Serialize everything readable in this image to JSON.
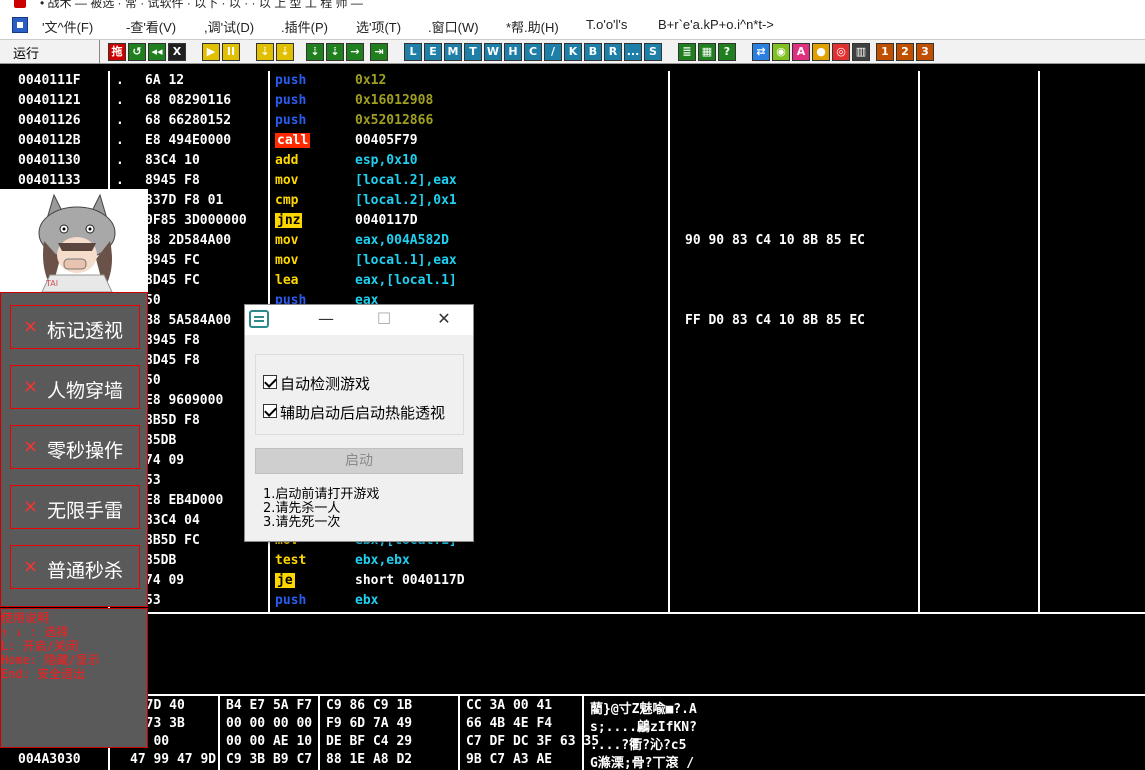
{
  "window": {
    "title_fragment": "• 战术 — 被选 · 常 · 试软件 · 以下 · 以 · · 以 上 型 工 程 师 —"
  },
  "menubar": {
    "items": [
      "'文^件(F)",
      "-查'看(V)",
      ",调'试(D)",
      ".插件(P)",
      "选'项(T)",
      ".窗口(W)",
      "*帮.助(H)",
      "T.o'o'l's",
      "B+r`e'a.kP+o.i^n*t->"
    ]
  },
  "toolbar": {
    "status": "运行",
    "buttons": [
      {
        "label": "拖",
        "bg": "#d00000"
      },
      {
        "label": "↺",
        "bg": "#208020"
      },
      {
        "label": "◂◂",
        "bg": "#208020"
      },
      {
        "label": "X",
        "bg": "#202020"
      },
      {
        "label": "▶",
        "bg": "#e0c000"
      },
      {
        "label": "II",
        "bg": "#e0c000"
      },
      {
        "label": "⇣",
        "bg": "#e0c000"
      },
      {
        "label": "⇣",
        "bg": "#e0c000"
      },
      {
        "label": "⇣",
        "bg": "#208020"
      },
      {
        "label": "⇣",
        "bg": "#208020"
      },
      {
        "label": "→",
        "bg": "#208020"
      },
      {
        "label": "⇥",
        "bg": "#208020"
      },
      {
        "label": "L",
        "bg": "#1e7fa8"
      },
      {
        "label": "E",
        "bg": "#1e7fa8"
      },
      {
        "label": "M",
        "bg": "#1e7fa8"
      },
      {
        "label": "T",
        "bg": "#1e7fa8"
      },
      {
        "label": "W",
        "bg": "#1e7fa8"
      },
      {
        "label": "H",
        "bg": "#1e7fa8"
      },
      {
        "label": "C",
        "bg": "#1e7fa8"
      },
      {
        "label": "/",
        "bg": "#1e7fa8"
      },
      {
        "label": "K",
        "bg": "#1e7fa8"
      },
      {
        "label": "B",
        "bg": "#1e7fa8"
      },
      {
        "label": "R",
        "bg": "#1e7fa8"
      },
      {
        "label": "...",
        "bg": "#1e7fa8"
      },
      {
        "label": "S",
        "bg": "#1e7fa8"
      },
      {
        "label": "≣",
        "bg": "#208020"
      },
      {
        "label": "▦",
        "bg": "#208020"
      },
      {
        "label": "?",
        "bg": "#208020"
      },
      {
        "label": "⇄",
        "bg": "#2a80e0"
      },
      {
        "label": "◉",
        "bg": "#80c020"
      },
      {
        "label": "A",
        "bg": "#e03080"
      },
      {
        "label": "●",
        "bg": "#e0a000"
      },
      {
        "label": "◎",
        "bg": "#e03030"
      },
      {
        "label": "▥",
        "bg": "#404040"
      },
      {
        "label": "1",
        "bg": "#c05000"
      },
      {
        "label": "2",
        "bg": "#c05000"
      },
      {
        "label": "3",
        "bg": "#c05000"
      }
    ]
  },
  "disasm_rows": [
    {
      "addr": "0040111F",
      "dot": ".",
      "hex": "6A 12",
      "mn": "push",
      "op": "0x12",
      "op_cls": "op-y",
      "cm": ""
    },
    {
      "addr": "00401121",
      "dot": ".",
      "hex": "68 08290116",
      "mn": "push",
      "op": "0x16012908",
      "op_cls": "op-y",
      "cm": ""
    },
    {
      "addr": "00401126",
      "dot": ".",
      "hex": "68 66280152",
      "mn": "push",
      "op": "0x52012866",
      "op_cls": "op-y",
      "cm": ""
    },
    {
      "addr": "0040112B",
      "dot": ".",
      "hex": "E8 494E0000",
      "mn": "call",
      "op": "00405F79",
      "op_cls": "op-w",
      "cm": ""
    },
    {
      "addr": "00401130",
      "dot": ".",
      "hex": "83C4 10",
      "mn": "add",
      "op": "esp,0x10",
      "op_cls": "op-c",
      "cm": ""
    },
    {
      "addr": "00401133",
      "dot": ".",
      "hex": "8945 F8",
      "mn": "mov",
      "op": "[local.2],eax",
      "op_cls": "op-c",
      "cm": ""
    },
    {
      "addr": "",
      "dot": "",
      "hex": "837D F8 01",
      "mn": "cmp",
      "op": "[local.2],0x1",
      "op_cls": "op-c",
      "cm": ""
    },
    {
      "addr": "",
      "dot": "",
      "hex": "0F85 3D000000",
      "mn": "jnz",
      "op": "0040117D",
      "op_cls": "op-w",
      "cm": ""
    },
    {
      "addr": "",
      "dot": "",
      "hex": "B8 2D584A00",
      "mn": "mov",
      "op": "eax,004A582D",
      "op_cls": "op-c",
      "cm": "90 90 83 C4 10 8B 85 EC"
    },
    {
      "addr": "",
      "dot": "",
      "hex": "8945 FC",
      "mn": "mov",
      "op": "[local.1],eax",
      "op_cls": "op-c",
      "cm": ""
    },
    {
      "addr": "",
      "dot": "",
      "hex": "8D45 FC",
      "mn": "lea",
      "op": "eax,[local.1]",
      "op_cls": "op-c",
      "cm": ""
    },
    {
      "addr": "",
      "dot": "",
      "hex": "50",
      "mn": "push",
      "op": "eax",
      "op_cls": "op-c",
      "cm": ""
    },
    {
      "addr": "",
      "dot": "",
      "hex": "B8 5A584A00",
      "mn": "",
      "op": "",
      "op_cls": "op-c",
      "cm": "FF D0 83 C4 10 8B 85 EC"
    },
    {
      "addr": "",
      "dot": "",
      "hex": "8945 F8",
      "mn": "",
      "op": "x",
      "op_cls": "op-c",
      "cm": ""
    },
    {
      "addr": "",
      "dot": "",
      "hex": "8D45 F8",
      "mn": "",
      "op": "]",
      "op_cls": "op-c",
      "cm": ""
    },
    {
      "addr": "",
      "dot": "",
      "hex": "50",
      "mn": "",
      "op": "",
      "op_cls": "op-c",
      "cm": ""
    },
    {
      "addr": "",
      "dot": "",
      "hex": "E8 9609000",
      "mn": "",
      "op": "",
      "op_cls": "op-c",
      "cm": ""
    },
    {
      "addr": "",
      "dot": "",
      "hex": "8B5D F8",
      "mn": "",
      "op": "]",
      "op_cls": "op-c",
      "cm": ""
    },
    {
      "addr": "",
      "dot": "",
      "hex": "85DB",
      "mn": "",
      "op": "",
      "op_cls": "op-c",
      "cm": ""
    },
    {
      "addr": "",
      "dot": "",
      "hex": "74 09",
      "mn": "",
      "op": "6D",
      "op_cls": "op-w",
      "cm": ""
    },
    {
      "addr": "",
      "dot": "",
      "hex": "53",
      "mn": "",
      "op": "",
      "op_cls": "op-c",
      "cm": ""
    },
    {
      "addr": "",
      "dot": "",
      "hex": "E8 EB4D000",
      "mn": "",
      "op": "",
      "op_cls": "op-c",
      "cm": ""
    },
    {
      "addr": "",
      "dot": "",
      "hex": "83C4 04",
      "mn": "",
      "op": "",
      "op_cls": "op-c",
      "cm": ""
    },
    {
      "addr": "",
      "dot": "",
      "hex": "8B5D FC",
      "mn": "mov",
      "op": "ebx,[local.1]",
      "op_cls": "op-c",
      "cm": ""
    },
    {
      "addr": "",
      "dot": "",
      "hex": "85DB",
      "mn": "test",
      "op": "ebx,ebx",
      "op_cls": "op-c",
      "cm": ""
    },
    {
      "addr": "",
      "dot": "",
      "hex": "74 09",
      "mn": "je",
      "op": "short 0040117D",
      "op_cls": "op-w",
      "cm": ""
    },
    {
      "addr": "00401174",
      "dot": ".",
      "hex": "53",
      "mn": "push",
      "op": "ebx",
      "op_cls": "op-c",
      "cm": ""
    }
  ],
  "dump_rows": [
    {
      "addr": "",
      "hex1": "2 7D 40",
      "hex2": "B4 E7 5A F7",
      "hex3": "C9 86 C9 1B",
      "hex4": "CC 3A 00 41",
      "ascii": "藺}@寸Z魅喩■?.A"
    },
    {
      "addr": "",
      "hex1": "D 73 3B",
      "hex2": "00 00 00 00",
      "hex3": "F9 6D 7A 49",
      "hex4": "66 4B 4E F4",
      "ascii": "  s;....鶣zIfKN?"
    },
    {
      "addr": "004A3020",
      "hex1": "00 00",
      "hex2": "00 00 AE 10",
      "hex3": "DE BF C4 29",
      "hex4": "C7 DF DC 3F 63 35",
      "ascii": "....?衢?沁?c5"
    },
    {
      "addr": "004A3030",
      "hex1": "47 99 47 9D",
      "hex2": "C9 3B B9 C7",
      "hex3": "88 1E A8 D2",
      "hex4": "9B C7 A3 AE",
      "ascii": "G滌溧;骨?丅滾 /"
    }
  ],
  "cheat_menu": {
    "items": [
      "标记透视",
      "人物穿墙",
      "零秒操作",
      "无限手雷",
      "普通秒杀"
    ],
    "mark": "×"
  },
  "usage": {
    "lines": [
      "使用说明",
      "↑ ↓ : 选择",
      "L: 开启/关闭",
      "Home: 隐藏/显示",
      "End: 安全退出"
    ]
  },
  "dialog": {
    "minimize": "—",
    "maximize": "☐",
    "close": "✕",
    "check1": "自动检测游戏",
    "check2": "辅助启动后启动热能透视",
    "start": "启动",
    "note1": "1.启动前请打开游戏",
    "note2": "2.请先杀一人",
    "note3": "3.请先死一次"
  }
}
